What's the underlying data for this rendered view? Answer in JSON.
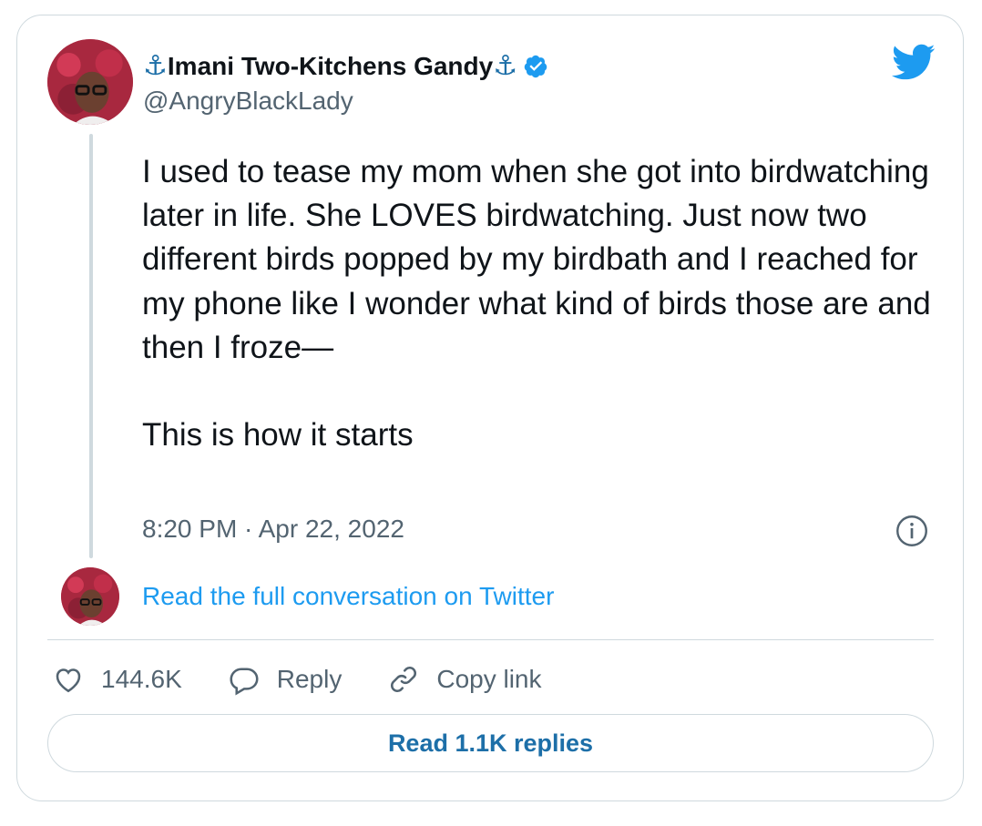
{
  "author": {
    "anchor_left": "⚓",
    "display_name": "Imani Two-Kitchens Gandy",
    "anchor_right": "⚓",
    "handle": "@AngryBlackLady",
    "verified": true
  },
  "tweet": {
    "text": "I used to tease my mom when she got into birdwatching later in life. She LOVES birdwatching. Just now two different birds popped by my birdbath and I reached for my phone like I wonder what kind of birds those are and then I froze—\n\nThis is how it starts",
    "timestamp": "8:20 PM · Apr 22, 2022"
  },
  "conversation_link": "Read the full conversation on Twitter",
  "actions": {
    "likes": "144.6K",
    "reply": "Reply",
    "copy_link": "Copy link"
  },
  "read_replies": "Read 1.1K replies",
  "colors": {
    "accent": "#1d9bf0",
    "button_text": "#1d6fa8",
    "secondary_text": "#536471",
    "border": "#cfd9de"
  },
  "icons": [
    "anchor-icon",
    "verified-badge-icon",
    "twitter-bird-icon",
    "info-icon",
    "heart-icon",
    "reply-bubble-icon",
    "link-icon"
  ]
}
